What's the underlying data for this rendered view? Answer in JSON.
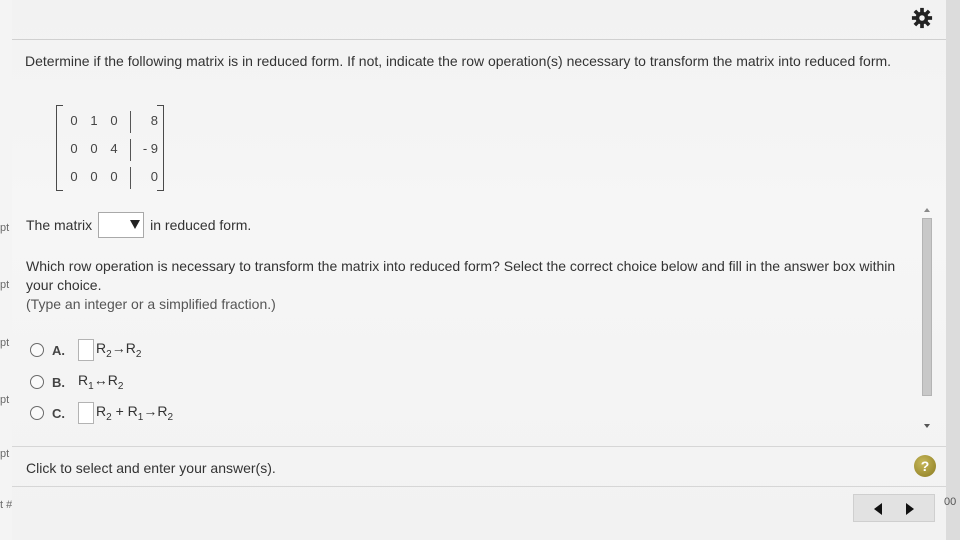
{
  "app": {
    "colors": {
      "accent_help": "#a8982f",
      "panel_bg": "#f4f4f4",
      "text": "#333333"
    }
  },
  "toolbar": {
    "settings_icon": "gear-icon"
  },
  "left_edge_fragments": [
    "pt",
    "pt",
    "pt",
    "pt",
    "pt",
    "t #"
  ],
  "question": {
    "text": "Determine if the following matrix is in reduced form. If not, indicate the row operation(s) necessary to transform the matrix into reduced form."
  },
  "matrix": {
    "rows": [
      {
        "cells": [
          "0",
          "1",
          "0"
        ],
        "aug": "8"
      },
      {
        "cells": [
          "0",
          "0",
          "4"
        ],
        "aug": "- 9"
      },
      {
        "cells": [
          "0",
          "0",
          "0"
        ],
        "aug": "0"
      }
    ]
  },
  "statement": {
    "prefix": "The matrix",
    "dropdown_value": "",
    "suffix": "in reduced form."
  },
  "sub_question": {
    "text": "Which row operation is necessary to transform the matrix into reduced form? Select the correct choice below and fill in the answer box within your choice.",
    "hint": "(Type an integer or a simplified fraction.)"
  },
  "choices": [
    {
      "letter": "A.",
      "has_box": true,
      "parts": [
        [
          "R",
          "2"
        ],
        [
          "→R",
          "2"
        ]
      ]
    },
    {
      "letter": "B.",
      "has_box": false,
      "parts": [
        [
          "R",
          "1"
        ],
        [
          "↔R",
          "2"
        ]
      ]
    },
    {
      "letter": "C.",
      "has_box": true,
      "parts": [
        [
          "R",
          "2"
        ],
        [
          " + R",
          "1"
        ],
        [
          "→R",
          "2"
        ]
      ]
    }
  ],
  "footer": {
    "instruction": "Click to select and enter your answer(s).",
    "help_label": "?"
  },
  "right_edge_fragment": "00"
}
